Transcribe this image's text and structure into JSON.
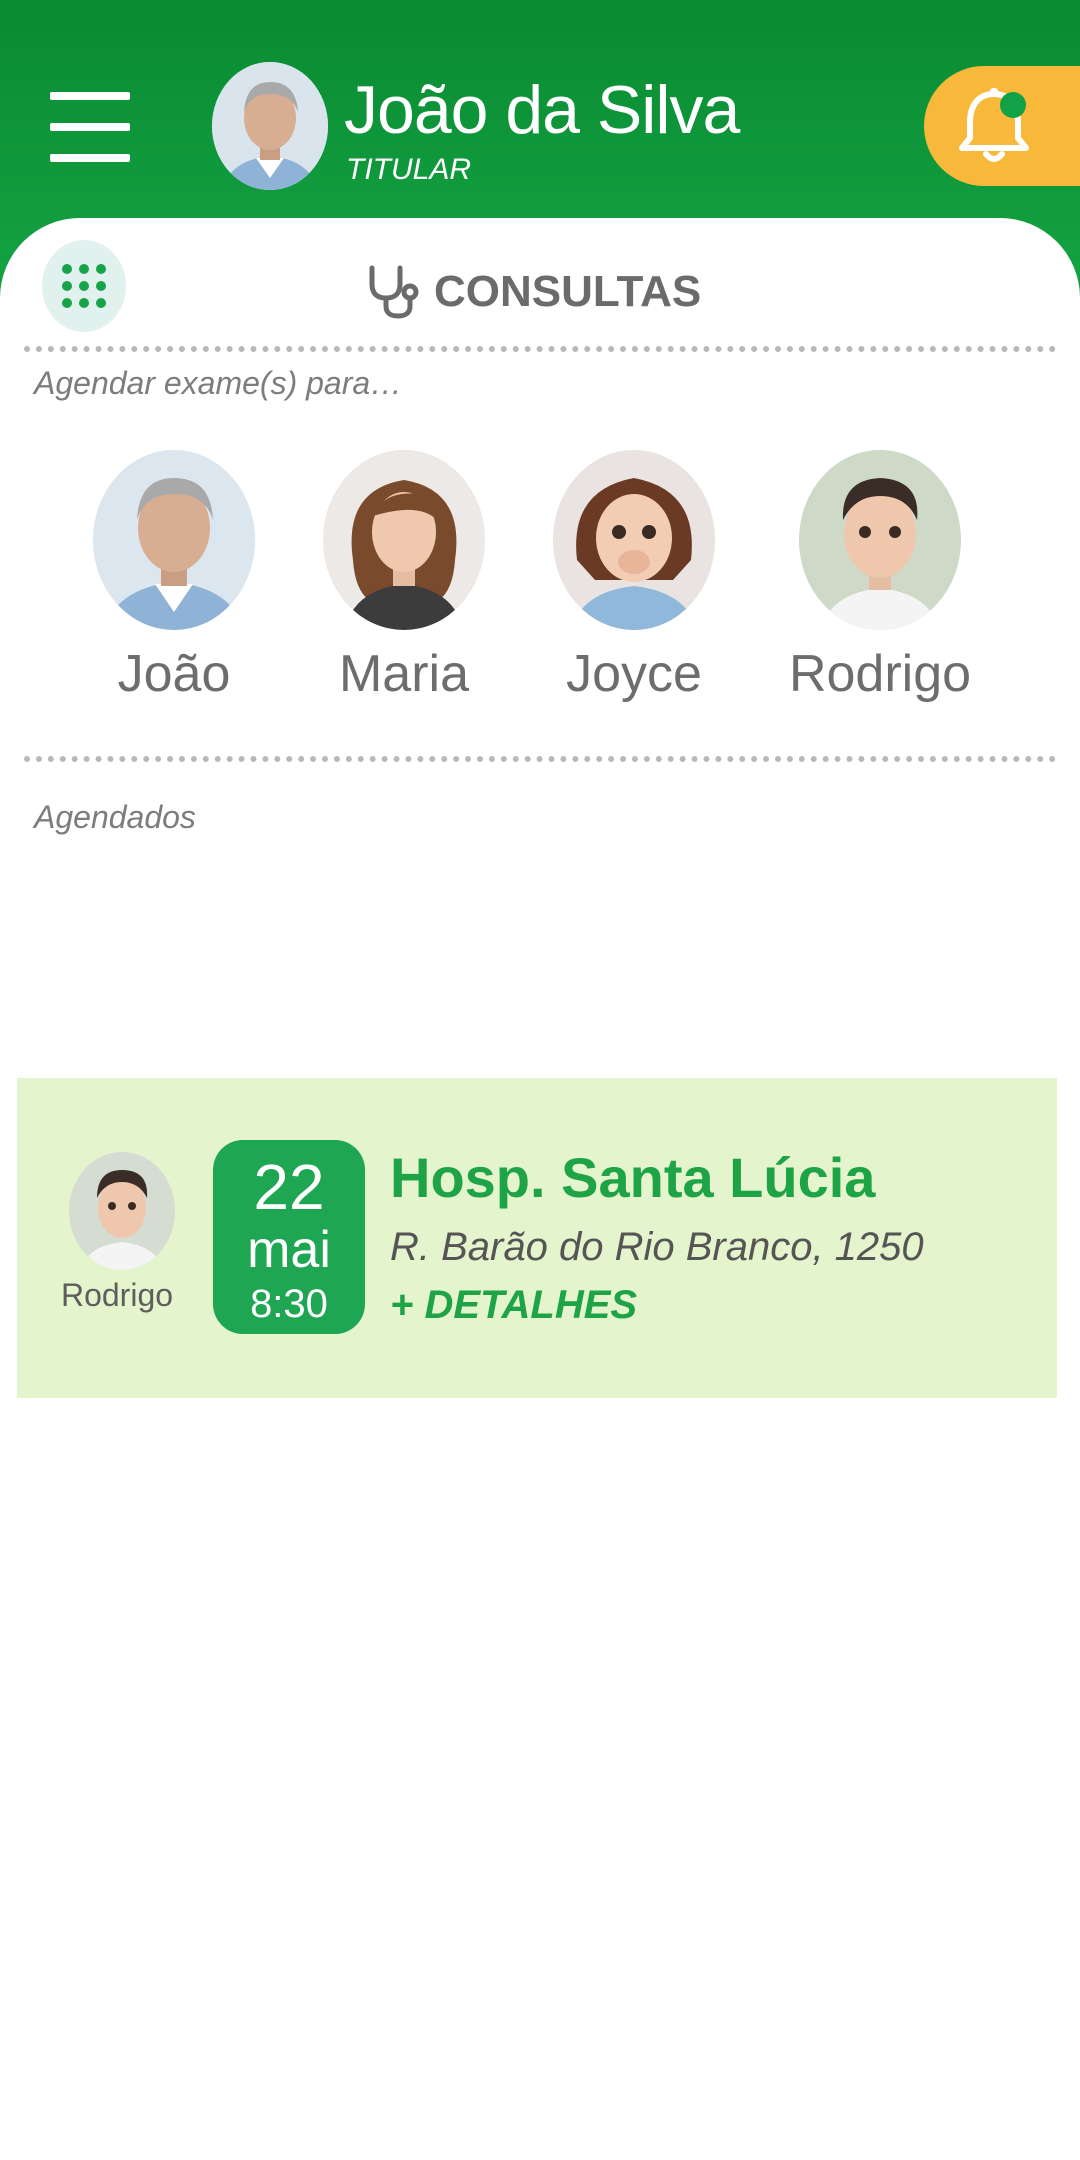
{
  "header": {
    "user_name": "João da Silva",
    "user_role": "TITULAR",
    "bg_color": "#12a146",
    "notification_color": "#f8b93b"
  },
  "section": {
    "title": "CONSULTAS",
    "icon": "stethoscope-icon",
    "schedule_label": "Agendar exame(s) para…",
    "scheduled_label": "Agendados"
  },
  "members": [
    {
      "name": "João"
    },
    {
      "name": "Maria"
    },
    {
      "name": "Joyce"
    },
    {
      "name": "Rodrigo"
    }
  ],
  "appointment": {
    "person": "Rodrigo",
    "day": "22",
    "month": "mai",
    "time": "8:30",
    "place": "Hosp. Santa Lúcia",
    "address": "R. Barão do Rio Branco, 1250",
    "details_label": "+ DETALHES",
    "bg_color": "#e4f4cc",
    "accent_color": "#1fa652"
  }
}
